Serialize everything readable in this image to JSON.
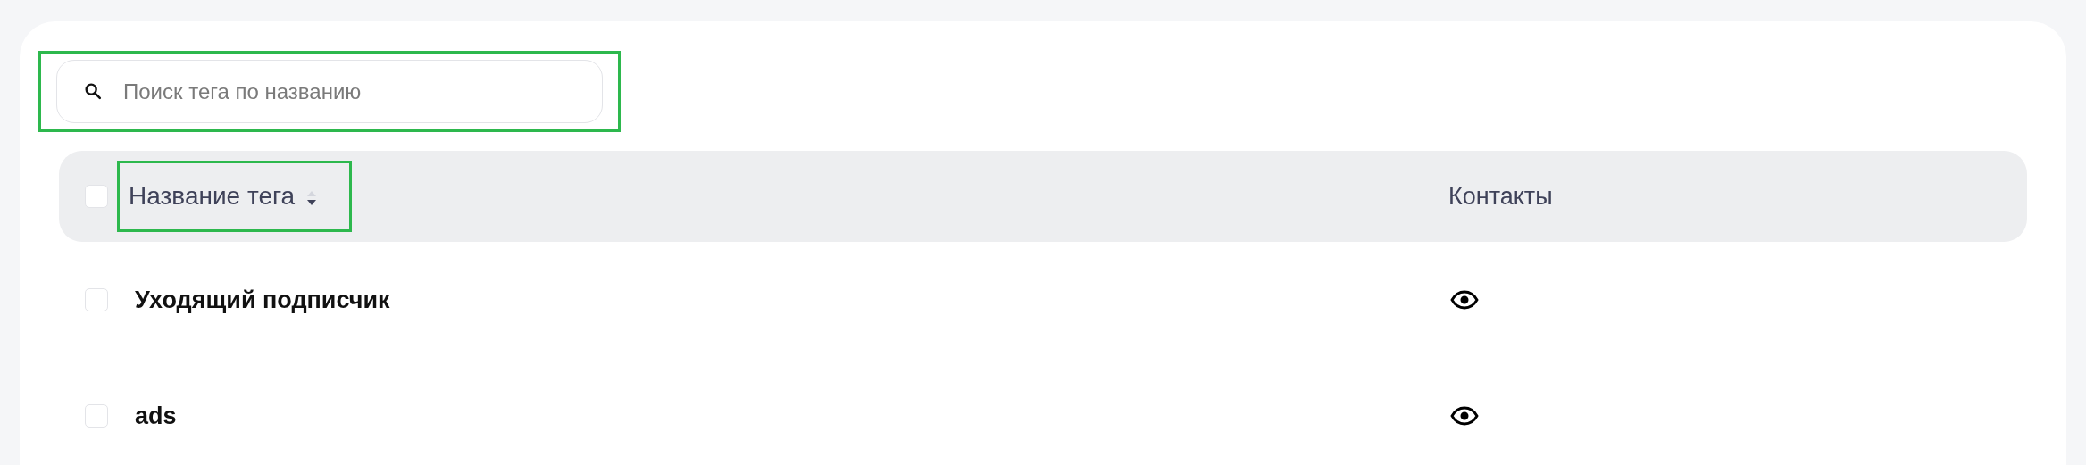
{
  "search": {
    "placeholder": "Поиск тега по названию",
    "highlighted": true
  },
  "table": {
    "select_all": {
      "checked": false
    },
    "columns": [
      {
        "label": "Название тега",
        "sorted_descending": true,
        "highlighted": true
      },
      {
        "label": "Контакты"
      }
    ],
    "rows": [
      {
        "name": "Уходящий подписчик",
        "checked": false
      },
      {
        "name": "ads",
        "checked": false
      }
    ]
  }
}
